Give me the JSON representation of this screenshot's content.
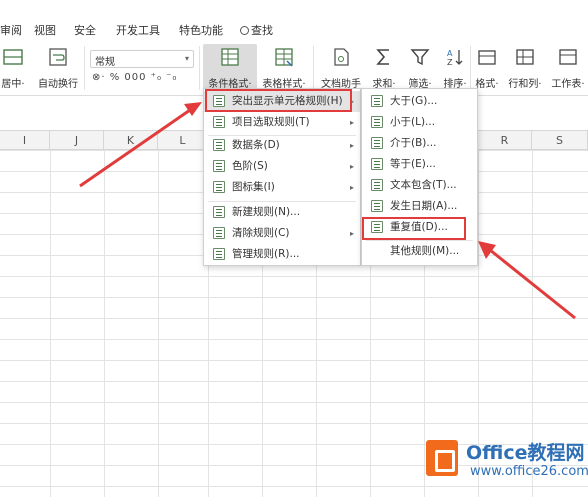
{
  "menubar": {
    "items": [
      "审阅",
      "视图",
      "安全",
      "开发工具",
      "特色功能",
      "查找"
    ]
  },
  "ribbon": {
    "merge_label": "居中·",
    "wrap_label": "自动换行",
    "number_format": "常规",
    "number_buttons": "⊗· % 000 ⁺₀ ⁻₀",
    "cond_format_label": "条件格式·",
    "table_style_label": "表格样式·",
    "doc_helper_label": "文档助手",
    "sum_label": "求和·",
    "filter_label": "筛选·",
    "sort_label": "排序·",
    "format_label": "格式·",
    "rowcol_label": "行和列·",
    "sheet_label": "工作表·"
  },
  "columns": [
    "I",
    "J",
    "K",
    "L",
    "R",
    "S"
  ],
  "main_menu": {
    "items": [
      {
        "label": "突出显示单元格规则(H)",
        "arrow": "▸"
      },
      {
        "label": "项目选取规则(T)",
        "arrow": "▸"
      },
      {
        "label": "数据条(D)",
        "arrow": "▸"
      },
      {
        "label": "色阶(S)",
        "arrow": "▸"
      },
      {
        "label": "图标集(I)",
        "arrow": "▸"
      },
      {
        "label": "新建规则(N)...",
        "arrow": ""
      },
      {
        "label": "清除规则(C)",
        "arrow": "▸"
      },
      {
        "label": "管理规则(R)...",
        "arrow": ""
      }
    ]
  },
  "sub_menu": {
    "items": [
      {
        "label": "大于(G)..."
      },
      {
        "label": "小于(L)..."
      },
      {
        "label": "介于(B)..."
      },
      {
        "label": "等于(E)..."
      },
      {
        "label": "文本包含(T)..."
      },
      {
        "label": "发生日期(A)..."
      },
      {
        "label": "重复值(D)..."
      },
      {
        "label": "其他规则(M)..."
      }
    ]
  },
  "watermark": {
    "title": "Office教程网",
    "url": "www.office26.com"
  },
  "colors": {
    "highlight": "#e23b3b",
    "logo_orange": "#f26b1d",
    "logo_blue": "#2f6fb6"
  }
}
